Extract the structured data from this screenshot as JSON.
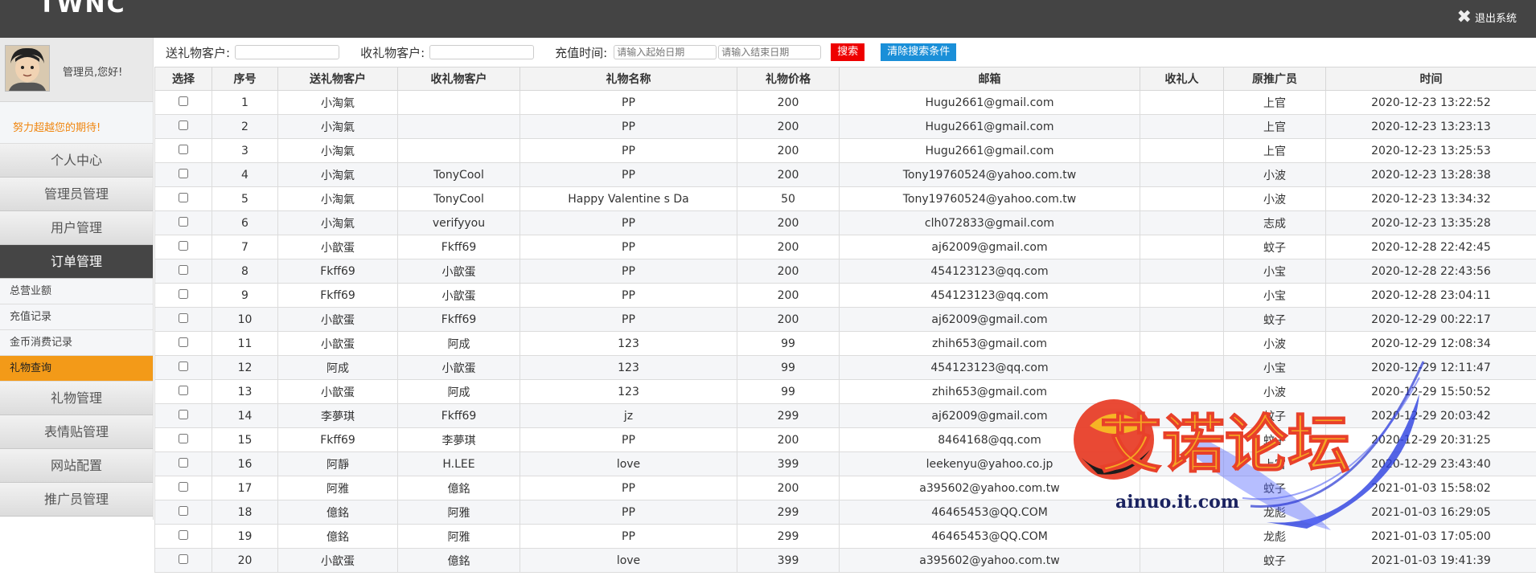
{
  "header": {
    "brand": "TWNC",
    "logout_label": "退出系统"
  },
  "sidebar": {
    "greeting": "管理员,您好!",
    "motto": "努力超越您的期待!",
    "menu": [
      {
        "label": "个人中心"
      },
      {
        "label": "管理员管理"
      },
      {
        "label": "用户管理"
      },
      {
        "label": "订单管理",
        "active": true
      }
    ],
    "submenu": [
      {
        "label": "总营业额"
      },
      {
        "label": "充值记录"
      },
      {
        "label": "金币消费记录"
      },
      {
        "label": "礼物查询",
        "active": true
      }
    ],
    "menu_after": [
      {
        "label": "礼物管理"
      },
      {
        "label": "表情贴管理"
      },
      {
        "label": "网站配置"
      },
      {
        "label": "推广员管理"
      }
    ]
  },
  "search": {
    "sender_label": "送礼物客户:",
    "receiver_label": "收礼物客户:",
    "time_label": "充值时间:",
    "start_placeholder": "请输入起始日期",
    "end_placeholder": "请输入结束日期",
    "search_button": "搜索",
    "clear_button": "清除搜索条件"
  },
  "table": {
    "headers": [
      "选择",
      "序号",
      "送礼物客户",
      "收礼物客户",
      "礼物名称",
      "礼物价格",
      "邮箱",
      "收礼人",
      "原推广员",
      "时间"
    ],
    "rows": [
      [
        "1",
        "小淘氣",
        "",
        "PP",
        "200",
        "Hugu2661@gmail.com",
        "",
        "上官",
        "2020-12-23 13:22:52"
      ],
      [
        "2",
        "小淘氣",
        "",
        "PP",
        "200",
        "Hugu2661@gmail.com",
        "",
        "上官",
        "2020-12-23 13:23:13"
      ],
      [
        "3",
        "小淘氣",
        "",
        "PP",
        "200",
        "Hugu2661@gmail.com",
        "",
        "上官",
        "2020-12-23 13:25:53"
      ],
      [
        "4",
        "小淘氣",
        "TonyCool",
        "PP",
        "200",
        "Tony19760524@yahoo.com.tw",
        "",
        "小波",
        "2020-12-23 13:28:38"
      ],
      [
        "5",
        "小淘氣",
        "TonyCool",
        "Happy Valentine s Da",
        "50",
        "Tony19760524@yahoo.com.tw",
        "",
        "小波",
        "2020-12-23 13:34:32"
      ],
      [
        "6",
        "小淘氣",
        "verifyyou",
        "PP",
        "200",
        "clh072833@gmail.com",
        "",
        "志成",
        "2020-12-23 13:35:28"
      ],
      [
        "7",
        "小歆蛋",
        "Fkff69",
        "PP",
        "200",
        "aj62009@gmail.com",
        "",
        "蚊子",
        "2020-12-28 22:42:45"
      ],
      [
        "8",
        "Fkff69",
        "小歆蛋",
        "PP",
        "200",
        "454123123@qq.com",
        "",
        "小宝",
        "2020-12-28 22:43:56"
      ],
      [
        "9",
        "Fkff69",
        "小歆蛋",
        "PP",
        "200",
        "454123123@qq.com",
        "",
        "小宝",
        "2020-12-28 23:04:11"
      ],
      [
        "10",
        "小歆蛋",
        "Fkff69",
        "PP",
        "200",
        "aj62009@gmail.com",
        "",
        "蚊子",
        "2020-12-29 00:22:17"
      ],
      [
        "11",
        "小歆蛋",
        "阿成",
        "123",
        "99",
        "zhih653@gmail.com",
        "",
        "小波",
        "2020-12-29 12:08:34"
      ],
      [
        "12",
        "阿成",
        "小歆蛋",
        "123",
        "99",
        "454123123@qq.com",
        "",
        "小宝",
        "2020-12-29 12:11:47"
      ],
      [
        "13",
        "小歆蛋",
        "阿成",
        "123",
        "99",
        "zhih653@gmail.com",
        "",
        "小波",
        "2020-12-29 15:50:52"
      ],
      [
        "14",
        "李夢琪",
        "Fkff69",
        "jz",
        "299",
        "aj62009@gmail.com",
        "",
        "蚊子",
        "2020-12-29 20:03:42"
      ],
      [
        "15",
        "Fkff69",
        "李夢琪",
        "PP",
        "200",
        "8464168@qq.com",
        "",
        "蚊子",
        "2020-12-29 20:31:25"
      ],
      [
        "16",
        "阿靜",
        "H.LEE",
        "love",
        "399",
        "leekenyu@yahoo.co.jp",
        "",
        "上官",
        "2020-12-29 23:43:40"
      ],
      [
        "17",
        "阿雅",
        "億銘",
        "PP",
        "200",
        "a395602@yahoo.com.tw",
        "",
        "蚊子",
        "2021-01-03 15:58:02"
      ],
      [
        "18",
        "億銘",
        "阿雅",
        "PP",
        "299",
        "46465453@QQ.COM",
        "",
        "龙彪",
        "2021-01-03 16:29:05"
      ],
      [
        "19",
        "億銘",
        "阿雅",
        "PP",
        "299",
        "46465453@QQ.COM",
        "",
        "龙彪",
        "2021-01-03 17:05:00"
      ],
      [
        "20",
        "小歆蛋",
        "億銘",
        "love",
        "399",
        "a395602@yahoo.com.tw",
        "",
        "蚊子",
        "2021-01-03 19:41:39"
      ]
    ]
  },
  "watermark": {
    "title": "艾诺论坛",
    "site": "ainuo.it.com"
  },
  "colors": {
    "header_bg": "#444444",
    "active_menu": "#454545",
    "active_submenu": "#f39a18",
    "search_btn": "#ee0000",
    "clear_btn": "#1a8fd8"
  }
}
